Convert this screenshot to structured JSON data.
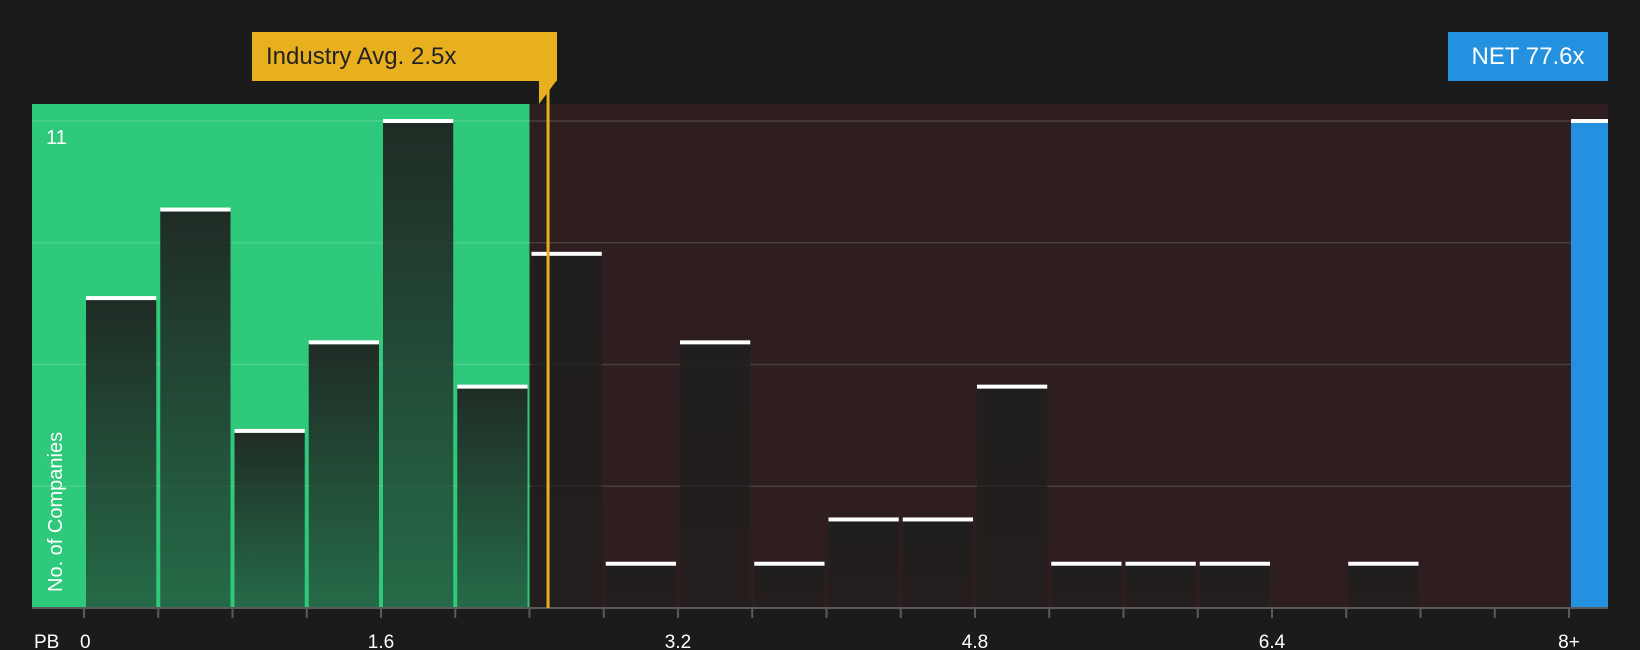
{
  "chart_data": {
    "type": "bar",
    "xlabel": "PB",
    "ylabel": "No. of Companies",
    "ylim": [
      0,
      11
    ],
    "y_ticks": [
      11
    ],
    "x_ticks": [
      "0",
      "1.6",
      "3.2",
      "4.8",
      "6.4",
      "8+"
    ],
    "bins": [
      {
        "x0": 0.0,
        "x1": 0.4,
        "value": 7
      },
      {
        "x0": 0.4,
        "x1": 0.8,
        "value": 9
      },
      {
        "x0": 0.8,
        "x1": 1.2,
        "value": 4
      },
      {
        "x0": 1.2,
        "x1": 1.6,
        "value": 6
      },
      {
        "x0": 1.6,
        "x1": 2.0,
        "value": 11
      },
      {
        "x0": 2.0,
        "x1": 2.4,
        "value": 5
      },
      {
        "x0": 2.4,
        "x1": 2.8,
        "value": 8
      },
      {
        "x0": 2.8,
        "x1": 3.2,
        "value": 1
      },
      {
        "x0": 3.2,
        "x1": 3.6,
        "value": 6
      },
      {
        "x0": 3.6,
        "x1": 4.0,
        "value": 1
      },
      {
        "x0": 4.0,
        "x1": 4.4,
        "value": 2
      },
      {
        "x0": 4.4,
        "x1": 4.8,
        "value": 2
      },
      {
        "x0": 4.8,
        "x1": 5.2,
        "value": 5
      },
      {
        "x0": 5.2,
        "x1": 5.6,
        "value": 1
      },
      {
        "x0": 5.6,
        "x1": 6.0,
        "value": 1
      },
      {
        "x0": 6.0,
        "x1": 6.4,
        "value": 1
      },
      {
        "x0": 6.4,
        "x1": 6.8,
        "value": 0
      },
      {
        "x0": 6.8,
        "x1": 7.2,
        "value": 1
      },
      {
        "x0": 7.2,
        "x1": 7.6,
        "value": 0
      },
      {
        "x0": 7.6,
        "x1": 8.0,
        "value": 0
      },
      {
        "x0": 8.0,
        "x1": 8.2,
        "value": 11,
        "highlight": true
      }
    ],
    "industry_avg": 2.5,
    "fair_region_end": 2.4,
    "annotations": {
      "industry_avg_label": "Industry Avg. 2.5x",
      "company_label": "NET 77.6x"
    },
    "colors": {
      "fair_region": "#2ec97a",
      "over_region": "#2e1e1f",
      "avg_line": "#e8b01f",
      "company_bar": "#2490e0",
      "bar_cap": "#ffffff"
    }
  }
}
